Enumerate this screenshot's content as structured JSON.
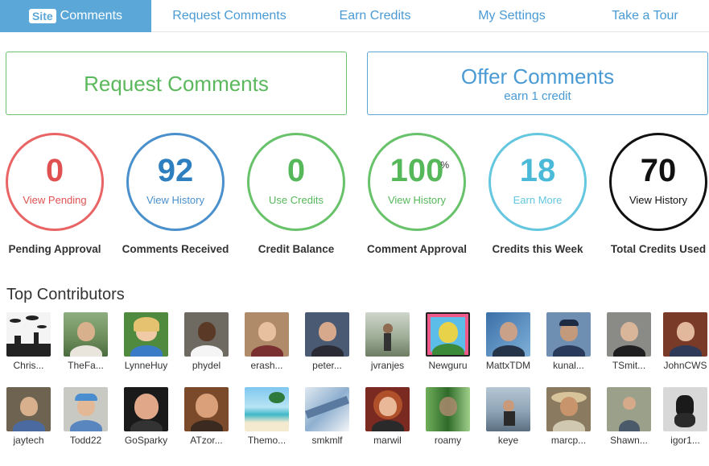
{
  "nav": {
    "site_badge": "Site",
    "tabs": [
      "Comments",
      "Request Comments",
      "Earn Credits",
      "My Settings",
      "Take a Tour"
    ]
  },
  "actions": {
    "request": {
      "title": "Request Comments"
    },
    "offer": {
      "title": "Offer Comments",
      "subtitle": "earn 1 credit"
    }
  },
  "stats": [
    {
      "value": "0",
      "link": "View Pending",
      "label": "Pending Approval",
      "color": "#e05252"
    },
    {
      "value": "92",
      "link": "View History",
      "label": "Comments Received",
      "color": "#2e7fc0"
    },
    {
      "value": "0",
      "link": "Use Credits",
      "label": "Credit Balance",
      "color": "#56b85a"
    },
    {
      "value": "100",
      "suffix": "%",
      "link": "View History",
      "label": "Comment Approval",
      "color": "#56b85a"
    },
    {
      "value": "18",
      "link": "Earn More",
      "label": "Credits this Week",
      "color": "#4bbad8"
    },
    {
      "value": "70",
      "link": "View History",
      "label": "Total Credits Used",
      "color": "#111111"
    }
  ],
  "contributors": {
    "title": "Top Contributors",
    "row1": [
      "Chris...",
      "TheFa...",
      "LynneHuy",
      "phydel",
      "erash...",
      "peter...",
      "jvranjes",
      "Newguru",
      "MattxTDM",
      "kunal...",
      "TSmit...",
      "JohnCWS"
    ],
    "row2": [
      "jaytech",
      "Todd22",
      "GoSparky",
      "ATzor...",
      "Themo...",
      "smkmlf",
      "marwil",
      "roamy",
      "keye",
      "marcp...",
      "Shawn...",
      "igor1..."
    ]
  }
}
